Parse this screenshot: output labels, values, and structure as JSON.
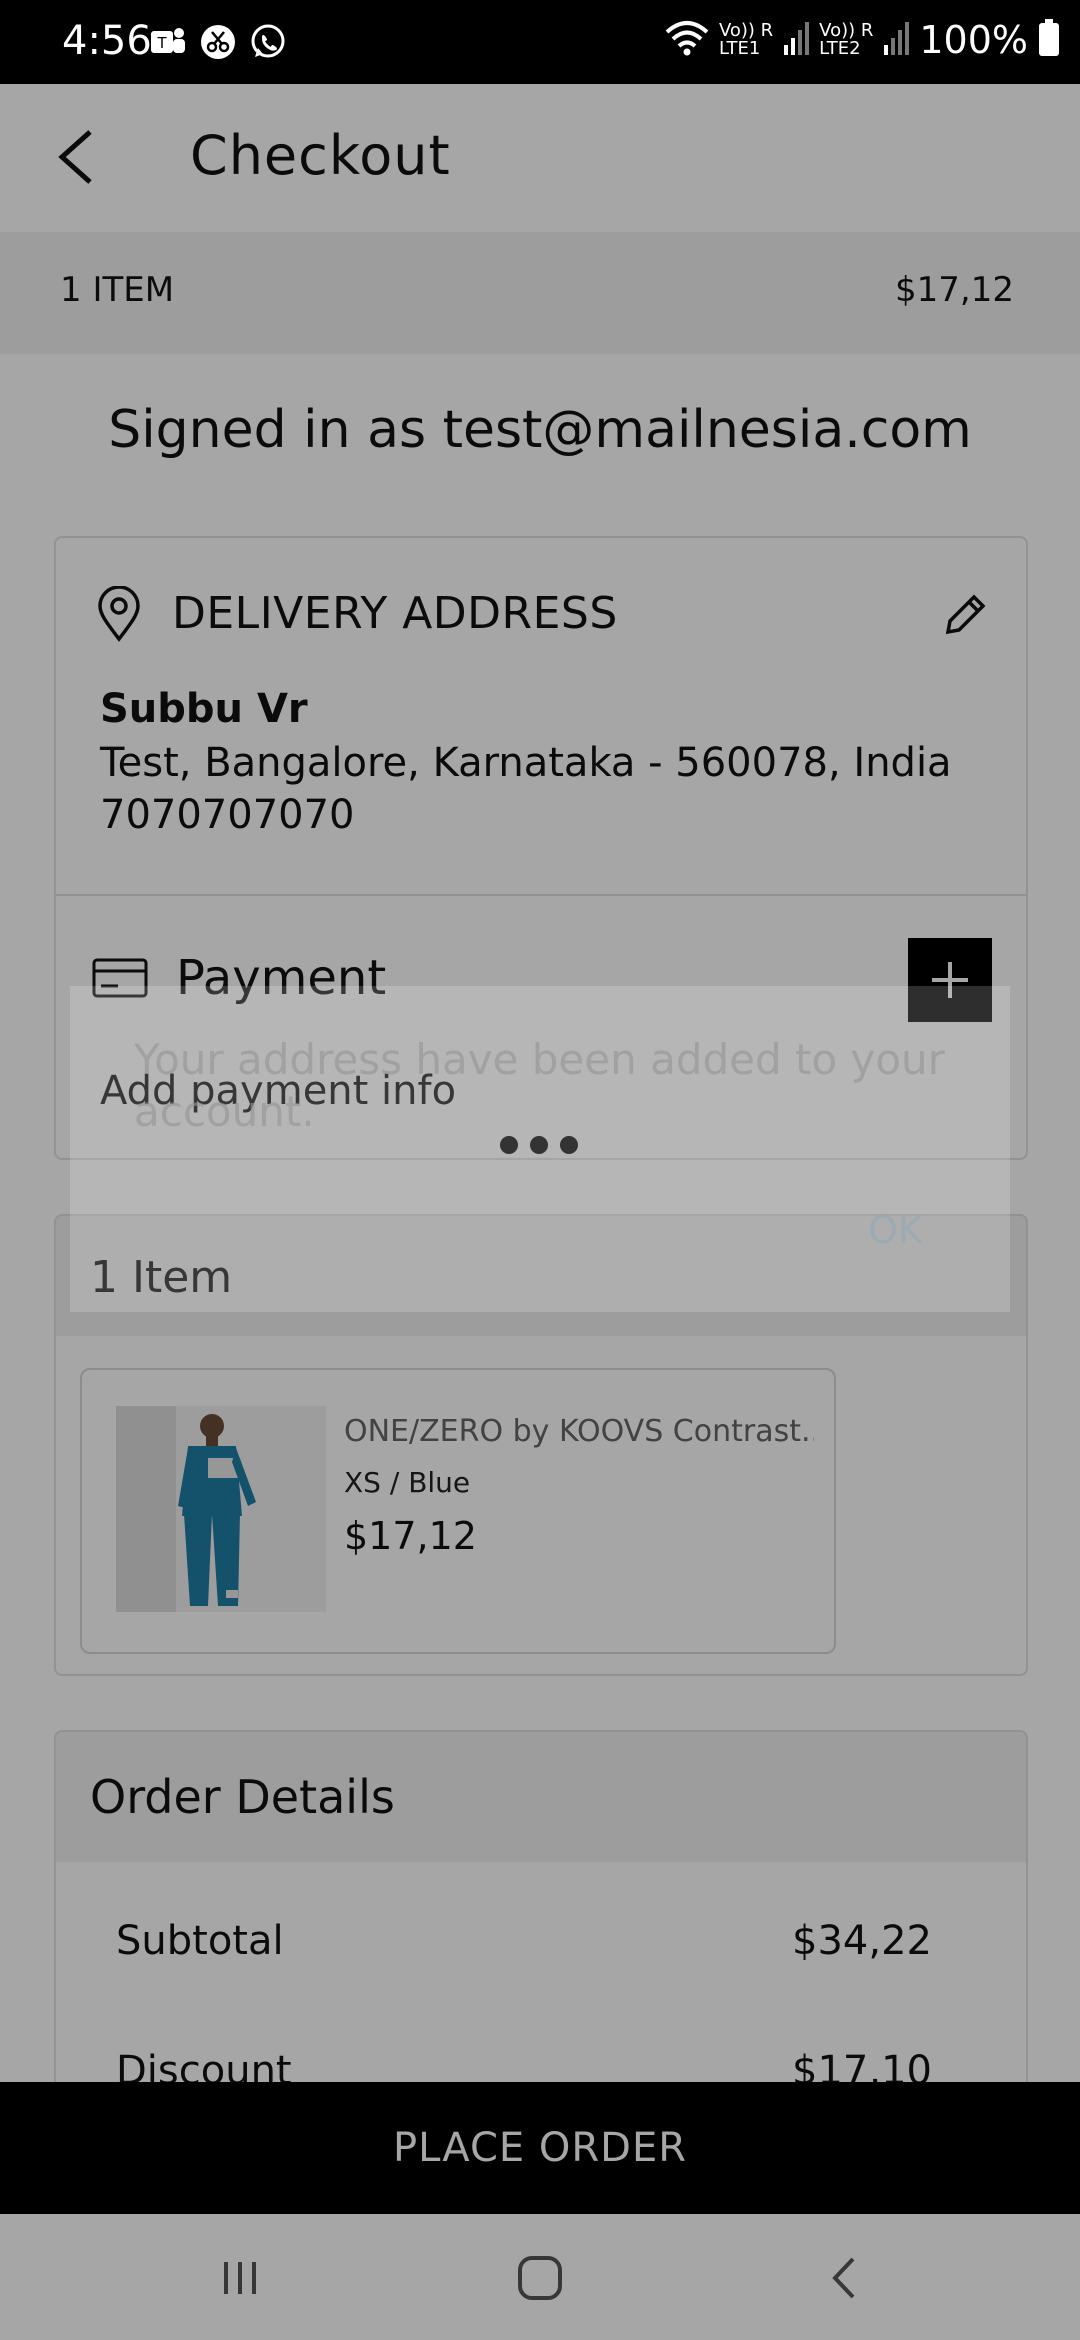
{
  "status_bar": {
    "time": "4:56",
    "battery": "100%",
    "net1": "Vo)) R\nLTE1",
    "net2": "Vo)) R\nLTE2",
    "icons": [
      "teams-icon",
      "scissors-icon",
      "whatsapp-icon",
      "wifi-icon",
      "signal-icon",
      "battery-icon"
    ]
  },
  "header": {
    "title": "Checkout"
  },
  "summary": {
    "count": "1 ITEM",
    "total": "$17,12"
  },
  "signed_in": "Signed in as test@mailnesia.com",
  "delivery": {
    "title": "DELIVERY ADDRESS",
    "name": "Subbu Vr",
    "address": "Test, Bangalore, Karnataka - 560078, India",
    "phone": "7070707070"
  },
  "payment": {
    "title": "Payment",
    "subtitle": "Add payment info"
  },
  "items": {
    "title": "1 Item",
    "product": {
      "name": "ONE/ZERO by KOOVS Contrast...",
      "variant": "XS / Blue",
      "price": "$17,12"
    }
  },
  "order_details": {
    "title": "Order Details",
    "rows": [
      {
        "label": "Subtotal",
        "value": "$34,22"
      },
      {
        "label": "Discount",
        "value": "$17,10"
      }
    ]
  },
  "place_order": "PLACE ORDER",
  "dialog": {
    "message": "Your address have been added to your account.",
    "ok": "OK"
  },
  "colors": {
    "accent": "#000000",
    "scrim": "rgba(0,0,0,0.35)",
    "product_blue": "#1f7fa6"
  }
}
